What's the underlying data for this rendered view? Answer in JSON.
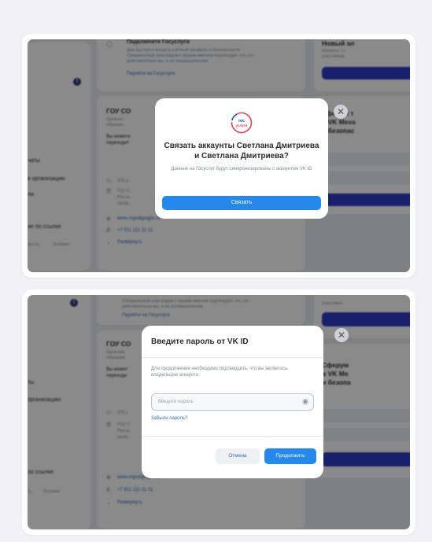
{
  "screen1": {
    "background": {
      "gosuslugi_title": "Подключите Госуслуги",
      "gosuslugi_desc_1": "Для быстрого входа в учётный профиль и безопасности",
      "gosuslugi_desc_2": "Специальный знак рядом с вашим именем подтвердит, что это",
      "gosuslugi_desc_3": "действительно вы, а не злоумышленник",
      "gosuslugi_link": "Перейти на Госуслуги",
      "org_title": "ГОУ СО",
      "org_sub": "Организ...",
      "org_sub_2": "образов...",
      "org_desc_1": "Вы можете",
      "org_desc_2": "переходит",
      "addr_1": "375 у...",
      "addr_2": "ГОУ С",
      "addr_3": "Росси...",
      "addr_4": "проф...",
      "website": "www.mgodigogpn.ru",
      "phone": "+7 911 111-11-11",
      "expand": "Развернуть",
      "left_1": "чаты",
      "left_2": "в организацию",
      "left_3": "ли",
      "left_4": "ие по ссылке",
      "left_5": "мость",
      "left_6": "Условия",
      "right_title_1": "Сферум т",
      "right_title_2": "в VK Mess",
      "right_title_3": "и безопас",
      "right_top": "Новый эл",
      "right_top_2": "Начните, ст",
      "right_top_3": "участников",
      "badge": "!"
    },
    "modal": {
      "logo_text_1": "гос",
      "logo_text_2": "услуги",
      "title": "Связать аккаунты Светлана Дмитриева и Светлана Дмитриева?",
      "subtitle": "Данные на Госуслуг будут синхронизированы с аккаунтом VK ID",
      "button": "Связать",
      "close": "✕"
    }
  },
  "screen2": {
    "background": {
      "top_desc_1": "Специальный знак рядом с вашим именем подтвердит, что это",
      "top_desc_2": "действительно вы, а не злоумышленник",
      "gosuslugi_link": "Перейти на Госуслуги",
      "org_title": "ГОУ СО",
      "org_sub": "Организа",
      "org_sub_2": "образова",
      "org_desc_1": "Вы может",
      "org_desc_2": "переходи",
      "addr_1": "375 у",
      "addr_2": "ГОУ С",
      "addr_3": "Росси",
      "addr_4": "проф",
      "website": "www.mgodigogpn.ru",
      "phone": "+7 911 111-11-11",
      "expand": "Развернуть",
      "left_1": "ты",
      "left_2": "организацию",
      "left_4": "по ссылке",
      "left_5": "ть",
      "left_6": "Условия",
      "right_title_1": "Сферум",
      "right_title_2": "в VK Me",
      "right_title_3": "и безопа",
      "right_top": "участника",
      "badge": "!"
    },
    "modal": {
      "title": "Введите пароль от VK ID",
      "description": "Для продолжения необходимо подтвердить, что вы являетесь владельцем аккаунта",
      "password_placeholder": "Введите пароль",
      "eye": "◉",
      "forgot": "Забыли пароль?",
      "cancel": "Отмена",
      "next": "Продолжить",
      "close": "✕"
    }
  },
  "colors": {
    "accent": "#2688eb",
    "dark_button": "#2d3cc7",
    "link": "#2d6fc4"
  }
}
